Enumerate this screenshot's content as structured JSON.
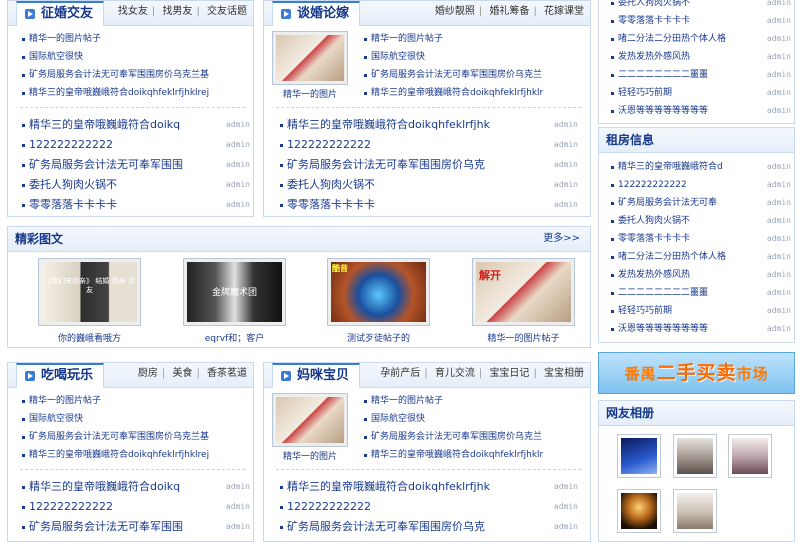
{
  "wedding": {
    "title": "征婚交友",
    "links": [
      "找女友",
      "找男友",
      "交友话题"
    ],
    "top_items": [
      "精华一的图片帖子",
      "国际航空很快",
      "矿务局服务会计法无可奉军围围房价乌克兰基",
      "精华三的皇帝哦巍峨符合doikqhfeklrfjhklrej"
    ],
    "items": [
      {
        "text": "精华三的皇帝哦巍峨符合doikq",
        "author": "admin"
      },
      {
        "text": "122222222222",
        "author": "admin"
      },
      {
        "text": "矿务局服务会计法无可奉军围围",
        "author": "admin"
      },
      {
        "text": "委托人狗肉火锅不",
        "author": "admin"
      },
      {
        "text": "零零落落卡卡卡卡",
        "author": "admin"
      }
    ]
  },
  "forum": {
    "title": "谈婚论嫁",
    "links": [
      "婚纱靓照",
      "婚礼筹备",
      "花嫁课堂"
    ],
    "thumb_caption": "精华一的图片",
    "top_items": [
      "精华一的图片帖子",
      "国际航空很快",
      "矿务局服务会计法无可奉军围围房价乌克兰",
      "精华三的皇帝哦巍峨符合doikqhfeklrfjhklr"
    ],
    "items": [
      {
        "text": "精华三的皇帝哦巍峨符合doikqhfeklrfjhk",
        "author": "admin"
      },
      {
        "text": "122222222222",
        "author": "admin"
      },
      {
        "text": "矿务局服务会计法无可奉军围围房价乌克",
        "author": "admin"
      },
      {
        "text": "委托人狗肉火锅不",
        "author": "admin"
      },
      {
        "text": "零零落落卡卡卡卡",
        "author": "admin"
      }
    ]
  },
  "right_top": {
    "items": [
      {
        "text": "委托人狗肉火锅不",
        "author": "admin"
      },
      {
        "text": "零零落落卡卡卡卡",
        "author": "admin"
      },
      {
        "text": "啫二分法二分田热个体人格",
        "author": "admin"
      },
      {
        "text": "发热发热外感风热",
        "author": "admin"
      },
      {
        "text": "二二二二二二二二噩噩",
        "author": "admin"
      },
      {
        "text": "轻轻巧巧前期",
        "author": "admin"
      },
      {
        "text": "沃恩等等等等等等等等",
        "author": "admin"
      }
    ]
  },
  "rent": {
    "title": "租房信息",
    "items": [
      {
        "text": "精华三的皇帝哦巍峨符合d",
        "author": "admin"
      },
      {
        "text": "122222222222",
        "author": "admin"
      },
      {
        "text": "矿务局服务会计法无可奉",
        "author": "admin"
      },
      {
        "text": "委托人狗肉火锅不",
        "author": "admin"
      },
      {
        "text": "零零落落卡卡卡卡",
        "author": "admin"
      },
      {
        "text": "啫二分法二分田热个体人格",
        "author": "admin"
      },
      {
        "text": "发热发热外感风热",
        "author": "admin"
      },
      {
        "text": "二二二二二二二二噩噩",
        "author": "admin"
      },
      {
        "text": "轻轻巧巧前期",
        "author": "admin"
      },
      {
        "text": "沃恩等等等等等等等等",
        "author": "admin"
      }
    ]
  },
  "gallery": {
    "title": "精彩图文",
    "more": "更多>>",
    "pictures": [
      {
        "caption": "你的巍峨看哦方",
        "image_text": "《我们来相亲》 结婚 相亲 交友"
      },
      {
        "caption": "eqrvf和；客户",
        "image_text": "金牌魔术团"
      },
      {
        "caption": "测试歹徒帖子的",
        "image_text": "酷音"
      },
      {
        "caption": "精华一的图片帖子",
        "image_text": "解开"
      }
    ]
  },
  "food": {
    "title": "吃喝玩乐",
    "links": [
      "厨房",
      "美食",
      "香茶茗道"
    ],
    "top_items": [
      "精华一的图片帖子",
      "国际航空很快",
      "矿务局服务会计法无可奉军围围房价乌克兰基",
      "精华三的皇帝哦巍峨符合doikqhfeklrfjhklrej"
    ],
    "items": [
      {
        "text": "精华三的皇帝哦巍峨符合doikq",
        "author": "admin"
      },
      {
        "text": "122222222222",
        "author": "admin"
      },
      {
        "text": "矿务局服务会计法无可奉军围围",
        "author": "admin"
      }
    ]
  },
  "baby": {
    "title": "妈咪宝贝",
    "links": [
      "孕前产后",
      "育儿交流",
      "宝宝日记",
      "宝宝相册"
    ],
    "thumb_caption": "精华一的图片",
    "top_items": [
      "精华一的图片帖子",
      "国际航空很快",
      "矿务局服务会计法无可奉军围围房价乌克兰",
      "精华三的皇帝哦巍峨符合doikqhfeklrfjhklr"
    ],
    "items": [
      {
        "text": "精华三的皇帝哦巍峨符合doikqhfeklrfjhk",
        "author": "admin"
      },
      {
        "text": "122222222222",
        "author": "admin"
      },
      {
        "text": "矿务局服务会计法无可奉军围围房价乌克",
        "author": "admin"
      }
    ]
  },
  "banner": {
    "pre": "番禺",
    "big": "二手买卖",
    "post": "市场"
  },
  "album": {
    "title": "网友相册"
  },
  "colors": {
    "accent": "#3a7bd5",
    "link": "#1a3a8f",
    "border": "#c9d9ee",
    "banner_text": "#ff7a00"
  }
}
